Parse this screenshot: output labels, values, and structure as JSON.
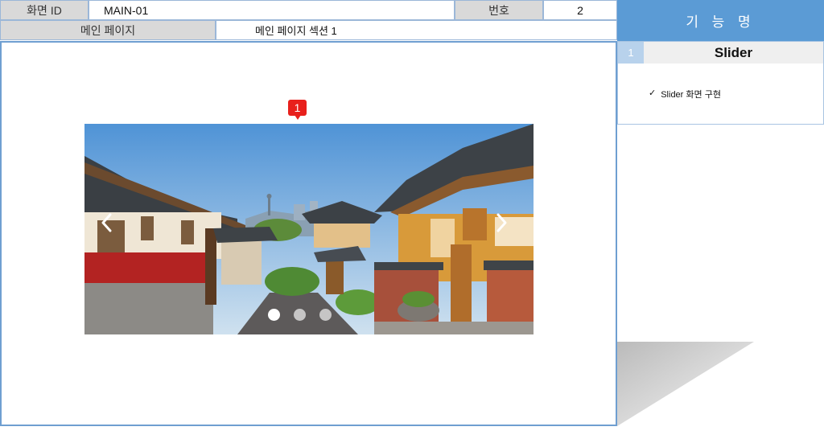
{
  "header": {
    "screen_id_label": "화면 ID",
    "screen_id_value": "MAIN-01",
    "number_label": "번호",
    "number_value": "2",
    "page_name": "메인 페이지",
    "section_name": "메인 페이지 섹션 1"
  },
  "feature_panel": {
    "title": "기 능 명",
    "item_number": "1",
    "item_name": "Slider",
    "description_check": "✓",
    "description": "Slider 화면 구현"
  },
  "marker": {
    "label": "1"
  },
  "slider": {
    "prev_icon": "chevron-left-icon",
    "next_icon": "chevron-right-icon",
    "dot_count": 3,
    "active_dot_index": 0,
    "image": "hanok-village-street-photo"
  },
  "colors": {
    "accent": "#5b9bd5",
    "panel_border": "#6f9fd1",
    "marker_red": "#e8201c",
    "header_gray": "#d9d9d9"
  }
}
